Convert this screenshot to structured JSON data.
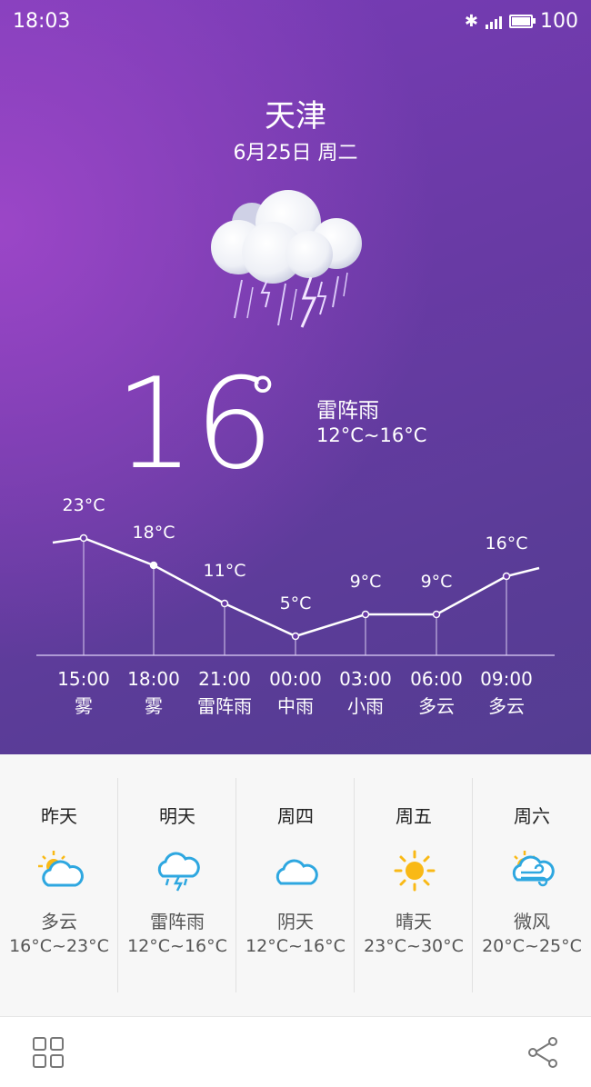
{
  "status": {
    "time": "18:03",
    "battery": "100"
  },
  "header": {
    "city": "天津",
    "date": "6月25日 周二"
  },
  "current": {
    "temp": "16",
    "degree": "°",
    "condition": "雷阵雨",
    "range": "12°C~16°C",
    "icon": "thunderstorm-cloud-icon"
  },
  "chart_data": {
    "type": "line",
    "x": [
      "15:00",
      "18:00",
      "21:00",
      "00:00",
      "03:00",
      "06:00",
      "09:00"
    ],
    "conditions": [
      "雾",
      "雾",
      "雷阵雨",
      "中雨",
      "小雨",
      "多云",
      "多云"
    ],
    "series": [
      {
        "values": [
          23,
          18,
          11,
          5,
          9,
          9,
          16
        ]
      }
    ],
    "labels": [
      "23°C",
      "18°C",
      "11°C",
      "5°C",
      "9°C",
      "9°C",
      "16°C"
    ]
  },
  "forecast": [
    {
      "name": "昨天",
      "icon": "partly-cloudy-icon",
      "desc": "多云",
      "range": "16°C~23°C"
    },
    {
      "name": "明天",
      "icon": "thunder-rain-icon",
      "desc": "雷阵雨",
      "range": "12°C~16°C"
    },
    {
      "name": "周四",
      "icon": "cloudy-icon",
      "desc": "阴天",
      "range": "12°C~16°C"
    },
    {
      "name": "周五",
      "icon": "sunny-icon",
      "desc": "晴天",
      "range": "23°C~30°C"
    },
    {
      "name": "周六",
      "icon": "breeze-icon",
      "desc": "微风",
      "range": "20°C~25°C"
    }
  ],
  "colors": {
    "sky": "#6a3aa6",
    "sun": "#f9b916",
    "cloud": "#2ea7e0"
  },
  "toolbar": {
    "left_icon": "grid-icon",
    "right_icon": "share-icon"
  }
}
